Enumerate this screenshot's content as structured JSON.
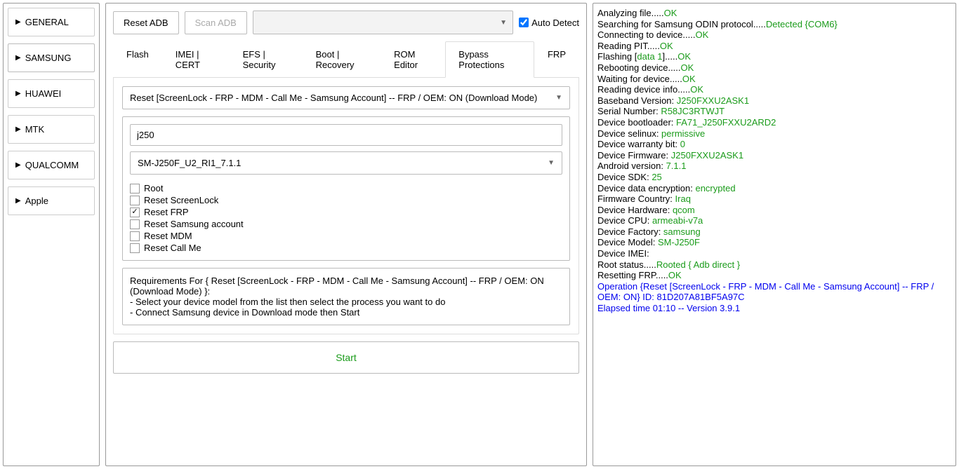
{
  "sidebar": {
    "items": [
      {
        "label": "GENERAL"
      },
      {
        "label": "SAMSUNG"
      },
      {
        "label": "HUAWEI"
      },
      {
        "label": "MTK"
      },
      {
        "label": "QUALCOMM"
      },
      {
        "label": "Apple"
      }
    ],
    "active": 1
  },
  "toolbar": {
    "reset_adb": "Reset ADB",
    "scan_adb": "Scan ADB",
    "auto_detect": "Auto Detect"
  },
  "tabs": [
    {
      "label": "Flash"
    },
    {
      "label": "IMEI | CERT"
    },
    {
      "label": "EFS | Security"
    },
    {
      "label": "Boot | Recovery"
    },
    {
      "label": "ROM Editor"
    },
    {
      "label": "Bypass Protections"
    },
    {
      "label": "FRP"
    }
  ],
  "active_tab": 5,
  "operation_select": "Reset [ScreenLock - FRP - MDM - Call Me - Samsung Account] -- FRP / OEM: ON (Download Mode)",
  "search_value": "j250",
  "model_select": "SM-J250F_U2_RI1_7.1.1",
  "options": [
    {
      "label": "Root",
      "checked": false
    },
    {
      "label": "Reset ScreenLock",
      "checked": false
    },
    {
      "label": "Reset FRP",
      "checked": true
    },
    {
      "label": "Reset Samsung account",
      "checked": false
    },
    {
      "label": "Reset MDM",
      "checked": false
    },
    {
      "label": "Reset Call Me",
      "checked": false
    }
  ],
  "requirements": {
    "title": "Requirements For { Reset [ScreenLock - FRP - MDM - Call Me - Samsung Account] -- FRP / OEM: ON (Download Mode) }:",
    "line1": " - Select your device model from the list then select the process you want to do",
    "line2": " - Connect Samsung device in Download mode then Start"
  },
  "start_label": "Start",
  "log": [
    [
      {
        "t": "Analyzing file....."
      },
      {
        "t": "OK",
        "c": "ok"
      }
    ],
    [
      {
        "t": "Searching for Samsung ODIN protocol....."
      },
      {
        "t": "Detected {COM6}",
        "c": "ok"
      }
    ],
    [
      {
        "t": "Connecting to device....."
      },
      {
        "t": "OK",
        "c": "ok"
      }
    ],
    [
      {
        "t": "Reading PIT....."
      },
      {
        "t": "OK",
        "c": "ok"
      }
    ],
    [
      {
        "t": "Flashing ["
      },
      {
        "t": "data 1",
        "c": "ok"
      },
      {
        "t": "]....."
      },
      {
        "t": "OK",
        "c": "ok"
      }
    ],
    [
      {
        "t": "Rebooting device....."
      },
      {
        "t": "OK",
        "c": "ok"
      }
    ],
    [
      {
        "t": "Waiting for device....."
      },
      {
        "t": "OK",
        "c": "ok"
      }
    ],
    [
      {
        "t": "Reading device info....."
      },
      {
        "t": "OK",
        "c": "ok"
      }
    ],
    [
      {
        "t": "Baseband Version: "
      },
      {
        "t": "J250FXXU2ASK1",
        "c": "ok"
      }
    ],
    [
      {
        "t": "Serial Number: "
      },
      {
        "t": "R58JC3RTWJT",
        "c": "ok"
      }
    ],
    [
      {
        "t": "Device bootloader: "
      },
      {
        "t": "FA71_J250FXXU2ARD2",
        "c": "ok"
      }
    ],
    [
      {
        "t": "Device selinux: "
      },
      {
        "t": "permissive",
        "c": "ok"
      }
    ],
    [
      {
        "t": "Device warranty bit: "
      },
      {
        "t": "0",
        "c": "ok"
      }
    ],
    [
      {
        "t": "Device Firmware: "
      },
      {
        "t": "J250FXXU2ASK1",
        "c": "ok"
      }
    ],
    [
      {
        "t": "Android version: "
      },
      {
        "t": "7.1.1",
        "c": "ok"
      }
    ],
    [
      {
        "t": "Device SDK: "
      },
      {
        "t": "25",
        "c": "ok"
      }
    ],
    [
      {
        "t": "Device data encryption: "
      },
      {
        "t": "encrypted",
        "c": "ok"
      }
    ],
    [
      {
        "t": "Firmware Country: "
      },
      {
        "t": "Iraq",
        "c": "ok"
      }
    ],
    [
      {
        "t": "Device Hardware: "
      },
      {
        "t": "qcom",
        "c": "ok"
      }
    ],
    [
      {
        "t": "Device CPU: "
      },
      {
        "t": "armeabi-v7a",
        "c": "ok"
      }
    ],
    [
      {
        "t": "Device Factory: "
      },
      {
        "t": "samsung",
        "c": "ok"
      }
    ],
    [
      {
        "t": "Device Model: "
      },
      {
        "t": "SM-J250F",
        "c": "ok"
      }
    ],
    [
      {
        "t": "Device IMEI: "
      }
    ],
    [
      {
        "t": "Root status....."
      },
      {
        "t": "Rooted { Adb direct }",
        "c": "ok"
      }
    ],
    [
      {
        "t": "Resetting FRP....."
      },
      {
        "t": "OK",
        "c": "ok"
      }
    ],
    [
      {
        "t": "Operation {Reset [ScreenLock - FRP - MDM - Call Me - Samsung Account] -- FRP / OEM: ON} ID: 81D207A81BF5A97C",
        "c": "blue"
      }
    ],
    [
      {
        "t": "Elapsed time 01:10 -- Version 3.9.1",
        "c": "blue"
      }
    ]
  ]
}
